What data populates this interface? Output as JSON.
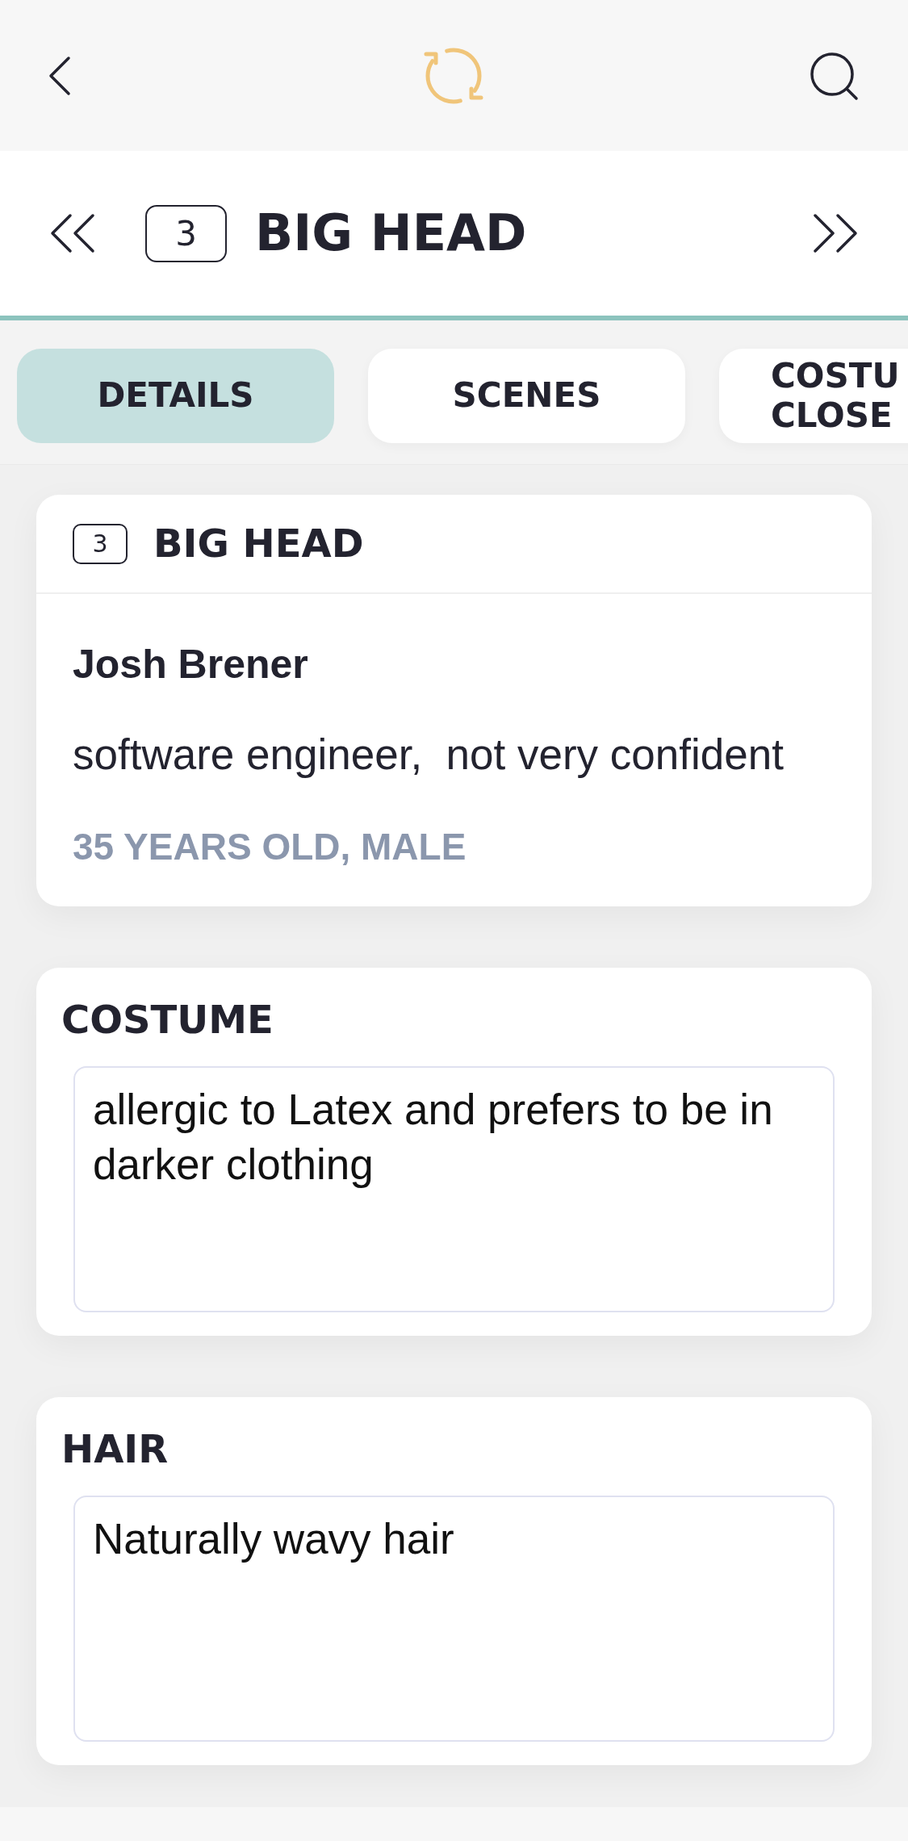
{
  "header": {
    "number": "3",
    "title": "BIG HEAD"
  },
  "tabs": [
    {
      "label": "DETAILS",
      "selected": true
    },
    {
      "label": "SCENES",
      "selected": false
    },
    {
      "label": "COSTU\nCLOSE",
      "selected": false
    }
  ],
  "character": {
    "number": "3",
    "title": "BIG HEAD",
    "actor": "Josh Brener",
    "description": "software engineer,  not very confident",
    "details": "35 YEARS OLD, MALE"
  },
  "notes": [
    {
      "label": "COSTUME",
      "value": "allergic to Latex and prefers to be in darker clothing"
    },
    {
      "label": "HAIR",
      "value": "Naturally wavy hair"
    }
  ]
}
